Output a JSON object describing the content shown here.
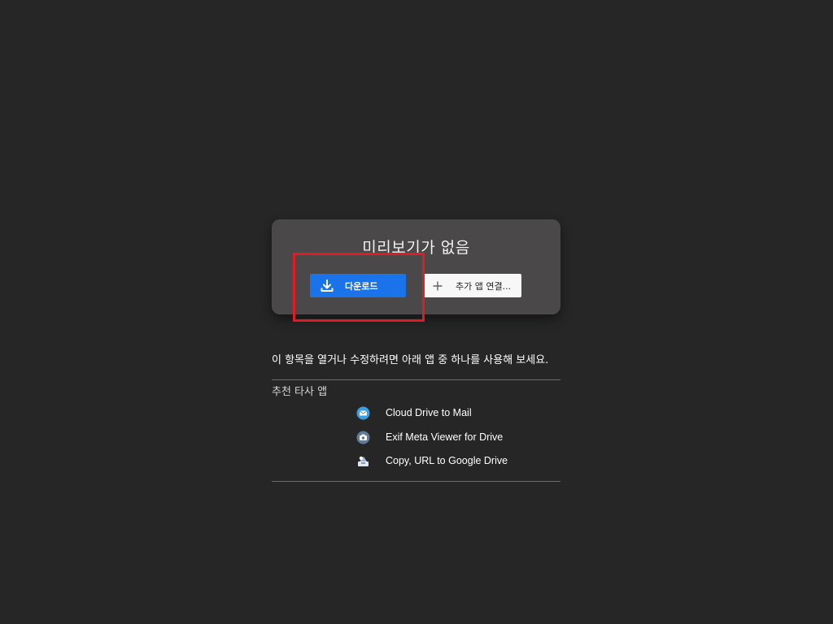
{
  "preview": {
    "title": "미리보기가 없음",
    "download_label": "다운로드",
    "connect_label": "추가 앱 연결..."
  },
  "open_with_text": "이 항목을 열거나 수정하려면 아래 앱 중 하나를 사용해 보세요.",
  "section_label": "추천 타사 앱",
  "apps": [
    {
      "name": "Cloud Drive to Mail",
      "icon": "mail-icon"
    },
    {
      "name": "Exif Meta Viewer for Drive",
      "icon": "camera-icon"
    },
    {
      "name": "Copy, URL to Google Drive",
      "icon": "cloud-copy-icon"
    }
  ],
  "colors": {
    "background": "#262626",
    "card": "#4a4849",
    "primary": "#1a73e8",
    "highlight": "#e01b24"
  }
}
